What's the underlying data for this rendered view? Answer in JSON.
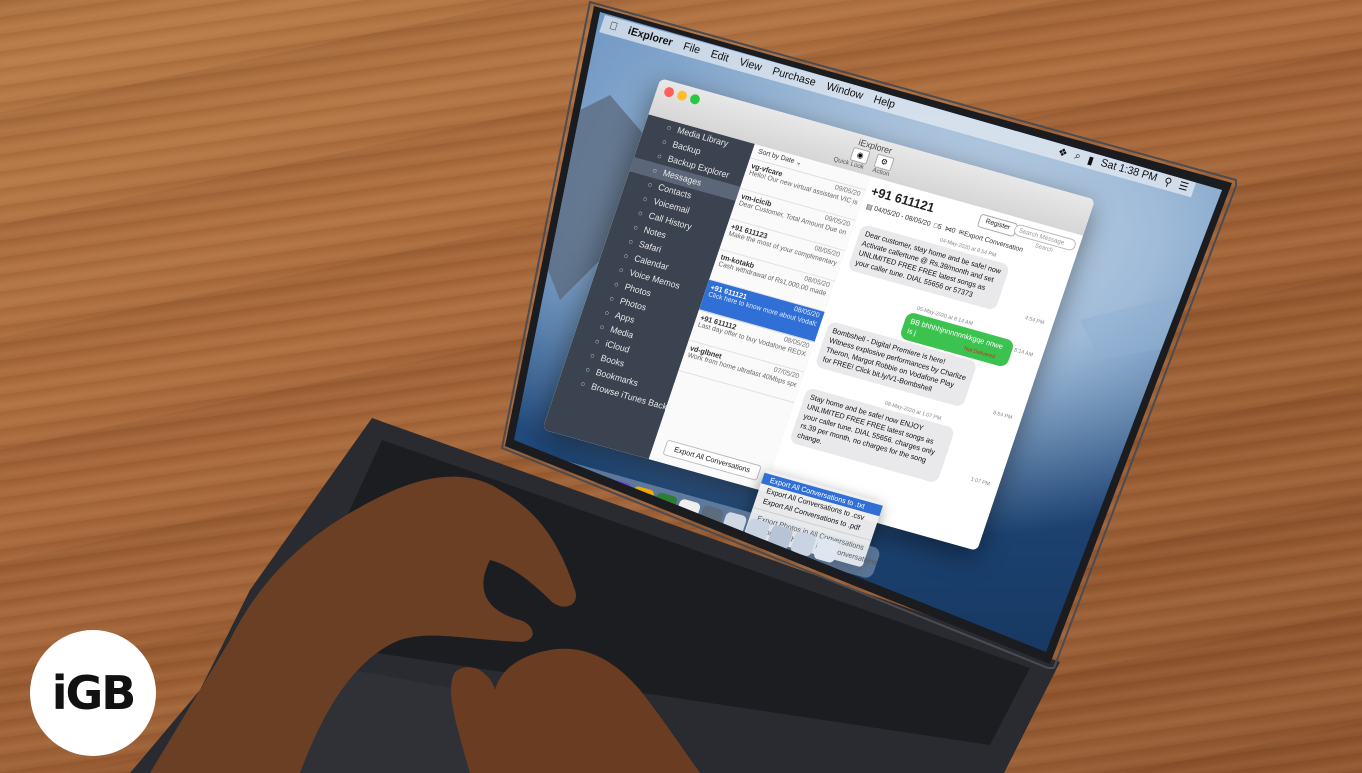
{
  "menubar": {
    "app_name": "iExplorer",
    "items": [
      "File",
      "Edit",
      "View",
      "Purchase",
      "Window",
      "Help"
    ],
    "clock": "Sat 1:38 PM"
  },
  "window": {
    "title": "iExplorer",
    "toolbar": {
      "quick_look": "Quick Look",
      "action": "Action"
    }
  },
  "sidebar": {
    "items": [
      {
        "label": "Media Library",
        "icon": "music-icon"
      },
      {
        "label": "Backup",
        "icon": "backup-icon"
      },
      {
        "label": "Backup Explorer",
        "icon": "backup-explorer-icon"
      },
      {
        "label": "Messages",
        "icon": "messages-icon",
        "selected": true
      },
      {
        "label": "Contacts",
        "icon": "contacts-icon"
      },
      {
        "label": "Voicemail",
        "icon": "voicemail-icon"
      },
      {
        "label": "Call History",
        "icon": "clock-icon"
      },
      {
        "label": "Notes",
        "icon": "notes-icon"
      },
      {
        "label": "Safari",
        "icon": "safari-icon"
      },
      {
        "label": "Calendar",
        "icon": "calendar-icon"
      },
      {
        "label": "Voice Memos",
        "icon": "microphone-icon"
      },
      {
        "label": "Photos",
        "icon": "camera-icon"
      },
      {
        "label": "Photos",
        "icon": "photos-icon"
      },
      {
        "label": "Apps",
        "icon": "apps-icon"
      },
      {
        "label": "Media",
        "icon": "media-icon"
      },
      {
        "label": "iCloud",
        "icon": "cloud-icon"
      },
      {
        "label": "Books",
        "icon": "books-icon"
      },
      {
        "label": "Bookmarks",
        "icon": "star-icon"
      },
      {
        "label": "Browse iTunes Backups",
        "icon": "browse-icon"
      }
    ]
  },
  "list": {
    "sort_label": "Sort by Date",
    "rows": [
      {
        "name": "vg-vfcare",
        "date": "09/05/20",
        "preview": "Hello! Our new virtual assistant VIC is now on WhatsApp, bringing you a wide range of services! Cl..."
      },
      {
        "name": "vm-icicib",
        "date": "09/05/20",
        "preview": "Dear Customer, Total Amount Due on Credit Card XX0000 is INR 6848.11. Amt will be debited fro..."
      },
      {
        "name": "+91 611123",
        "date": "08/05/20",
        "preview": "Make the most of your complimentary premium membership of Zee5 worth Rs.500 with yo..."
      },
      {
        "name": "tm-kotakb",
        "date": "08/05/20",
        "preview": "Cash withdrawal of Rs1,000.00 made on Kotak Debit Card X1980 on 08-05-2020 at TIRN HSAO At..."
      },
      {
        "name": "+91 611121",
        "date": "08/05/20",
        "preview": "Click here to know more about Vodafone Play UNLIMITED EDITION vi bit.ly/VP-20",
        "selected": true
      },
      {
        "name": "+91 611112",
        "date": "08/05/20",
        "preview": "Last day offer to buy Vodafone REDX - a UNLIMITED EDITION Postpaid Plan @ Rs.999 Monthly..."
      },
      {
        "name": "vd-glbnet",
        "date": "07/05/20",
        "preview": "Work from home ultrafast 40Mbps speed..."
      }
    ],
    "export_button": "Export All Conversations"
  },
  "conversation": {
    "contact": "+91 611121",
    "register_button": "Register",
    "search_placeholder": "Search Message",
    "search_label": "Search",
    "date_range": "04/05/20 - 08/05/20",
    "message_count": "5",
    "attachment_count": "0",
    "export_link": "Export Conversation",
    "messages": [
      {
        "stamp": "04-May-2020 at 8:54 PM",
        "text": "Dear customer, stay home and be safe! now Activate callertune @ Rs.39/month and set UNLIMITED FREE FREE latest songs as your caller tune. DIAL 55656 or 57373",
        "time": "4:54 PM",
        "type": "received"
      },
      {
        "stamp": "05-May-2020 at 8:14 AM",
        "text": "BB bhhhhjnnnnnnkkgqe nnwe is j",
        "time": "8:14 AM",
        "type": "sent",
        "status": "Not Delivered"
      },
      {
        "stamp": "",
        "text": "Bombshell - Digital Premiere is here! Witness explosive performances by Charlize Theron, Margot Robbie on Vodafone Play for FREE! Click bit.ly/V1-Bombshell",
        "time": "8:54 PM",
        "type": "received"
      },
      {
        "stamp": "08-May-2020 at 1:07 PM",
        "text": "Stay home and be safe! now ENJOY UNLIMITED FREE FREE latest songs as your caller tune. DIAL 55656. charges only rs.39 per month, no charges for the song change.",
        "time": "1:07 PM",
        "type": "received"
      }
    ]
  },
  "context_menu": {
    "items": [
      {
        "label": "Export All Conversations to .txt",
        "highlighted": true
      },
      {
        "label": "Export All Conversations to .csv"
      },
      {
        "label": "Export All Conversations to .pdf"
      },
      {
        "separator": true
      },
      {
        "label": "Export Photos in All Conversations"
      },
      {
        "label": "Export Attachments in All Conversations"
      }
    ]
  },
  "logo": {
    "text": "iGB"
  },
  "colors": {
    "wood": "#a8683a",
    "selection": "#2f6fd6",
    "sidebar": "#3b4350",
    "sent_bubble": "#3cc24f",
    "received_bubble": "#e9e9eb"
  }
}
